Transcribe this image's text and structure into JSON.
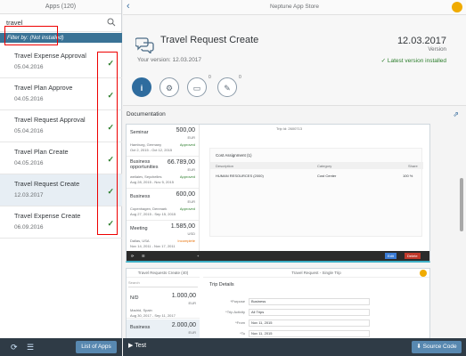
{
  "left": {
    "header": "Apps (120)",
    "search_value": "travel",
    "filter_text": "Filter by: (Not installed)",
    "apps": [
      {
        "name": "Travel Expense Approval",
        "date": "05.04.2016"
      },
      {
        "name": "Travel Plan Approve",
        "date": "04.05.2016"
      },
      {
        "name": "Travel Request Approval",
        "date": "05.04.2016"
      },
      {
        "name": "Travel Plan Create",
        "date": "04.05.2016"
      },
      {
        "name": "Travel Request Create",
        "date": "12.03.2017"
      },
      {
        "name": "Travel Expense Create",
        "date": "06.09.2016"
      }
    ],
    "list_apps_label": "List of Apps"
  },
  "top": {
    "title": "Neptune App Store"
  },
  "header": {
    "title": "Travel Request Create",
    "version_text": "Your version: 12.03.2017",
    "date": "12.03.2017",
    "date_label": "Version",
    "status": "Latest version installed"
  },
  "tabs": {
    "counts": [
      "0",
      "0"
    ]
  },
  "documentation": {
    "label": "Documentation"
  },
  "preview1": {
    "trip_label": "Trip Id:  2600713",
    "items": [
      {
        "name": "Seminar",
        "amount": "500,00",
        "currency": "EUR",
        "location": "Hamburg, Germany",
        "dates": "Oct 2, 2015 - Oct 12, 2015",
        "status": "Approved",
        "status_color": "#2b7d2b"
      },
      {
        "name": "Business opportunities",
        "amount": "66.789,00",
        "currency": "EUR",
        "location": "weilaiev, Seychelles",
        "dates": "Aug 28, 2015 - Nov 5, 2015",
        "status": "Approved",
        "status_color": "#2b7d2b"
      },
      {
        "name": "Business",
        "amount": "600,00",
        "currency": "EUR",
        "location": "Copenhagen, Denmark",
        "dates": "Aug 27, 2015 - Sep 15, 2015",
        "status": "Approved",
        "status_color": "#2b7d2b"
      },
      {
        "name": "Meeting",
        "amount": "1.585,00",
        "currency": "USD",
        "location": "Dallas, USA",
        "dates": "Nov 14, 2011 - Nov 17, 2011",
        "status": "Incomplete",
        "status_color": "#e9730c"
      }
    ],
    "cost_title": "Cost Assignment (1)",
    "cost_headers": [
      "Description",
      "Category",
      "Share"
    ],
    "cost_row": [
      "HUMAN RESOURCES (2000)",
      "Cost Center",
      "100 %"
    ],
    "edit_label": "Edit",
    "delete_label": "Delete"
  },
  "preview2": {
    "left_title": "Travel Requests Create (40)",
    "right_title": "Travel Request - Single Trip",
    "search_placeholder": "Search",
    "items": [
      {
        "name": "N/D",
        "amount": "1.000,00",
        "currency": "EUR",
        "location": "Madrid, Spain",
        "dates": "Aug 30, 2017 - Sep 11, 2017"
      },
      {
        "name": "Business",
        "amount": "2.000,00",
        "currency": "EUR",
        "location": "",
        "dates": ""
      }
    ],
    "trip_details": "Trip Details",
    "fields": [
      {
        "label": "*Purpose",
        "value": "Business"
      },
      {
        "label": "*Trip Activity",
        "value": "All Trips"
      },
      {
        "label": "*From",
        "value": "Nov 11, 2015"
      },
      {
        "label": "*To",
        "value": "Nov 11, 2015"
      }
    ]
  },
  "footer": {
    "test_label": "Test",
    "source_label": "Source Code"
  },
  "colors": {
    "accent": "#2f6c9e",
    "footer_bg": "#2f3b46",
    "success": "#2b7d2b",
    "highlight_box": "#e00000"
  }
}
